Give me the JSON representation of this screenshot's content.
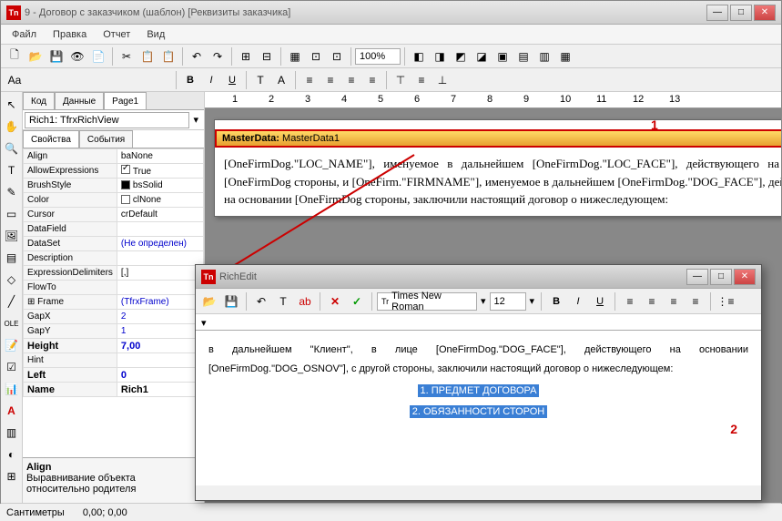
{
  "window": {
    "title": "9 - Договор с заказчиком (шаблон) [Реквизиты заказчика]"
  },
  "menu": {
    "file": "Файл",
    "edit": "Правка",
    "report": "Отчет",
    "view": "Вид"
  },
  "zoom": "100%",
  "pagetabs": {
    "code": "Код",
    "data": "Данные",
    "page": "Page1"
  },
  "objsel": "Rich1: TfrxRichView",
  "proptabs": {
    "props": "Свойства",
    "events": "События"
  },
  "props": [
    {
      "n": "Align",
      "v": "baNone"
    },
    {
      "n": "AllowExpressions",
      "v": "True",
      "chk": true,
      "blue": false
    },
    {
      "n": "BrushStyle",
      "v": "bsSolid",
      "sq": "#000"
    },
    {
      "n": "Color",
      "v": "clNone",
      "sq": "#fff"
    },
    {
      "n": "Cursor",
      "v": "crDefault"
    },
    {
      "n": "DataField",
      "v": ""
    },
    {
      "n": "DataSet",
      "v": "(Не определен)",
      "blue": true
    },
    {
      "n": "Description",
      "v": ""
    },
    {
      "n": "ExpressionDelimiters",
      "v": "[,]"
    },
    {
      "n": "FlowTo",
      "v": ""
    },
    {
      "n": "Frame",
      "v": "(TfrxFrame)",
      "blue": true,
      "exp": true
    },
    {
      "n": "GapX",
      "v": "2",
      "blue": true
    },
    {
      "n": "GapY",
      "v": "1",
      "blue": true
    },
    {
      "n": "Height",
      "v": "7,00",
      "blue": true,
      "bold": true
    },
    {
      "n": "Hint",
      "v": ""
    },
    {
      "n": "Left",
      "v": "0",
      "blue": true,
      "bold": true
    },
    {
      "n": "Name",
      "v": "Rich1",
      "bold": true
    }
  ],
  "propdesc": {
    "title": "Align",
    "text": "Выравнивание объекта относительно родителя"
  },
  "status": {
    "l": "Сантиметры",
    "r": "0,00; 0,00"
  },
  "band": {
    "label": "MasterData:",
    "name": "MasterData1"
  },
  "ruler": [
    "1",
    "2",
    "3",
    "4",
    "5",
    "6",
    "7",
    "8",
    "9",
    "10",
    "11",
    "12",
    "13"
  ],
  "doc": "[OneFirmDog.\"LOC_NAME\"], именуемое в дальнейшем [OneFirmDog.\"LOC_FACE\"], действующего на основании [OneFirmDog стороны, и [OneFirm.\"FIRMNAME\"], именуемое в дальнейшем [OneFirmDog.\"DOG_FACE\"], действующего на основании [OneFirmDog стороны, заключили настоящий договор о нижеследующем:",
  "subwin": {
    "title": "RichEdit"
  },
  "subfont": "Times New Roman",
  "subsize": "12",
  "subtext": "в дальнейшем \"Клиент\", в лице [OneFirmDog.\"DOG_FACE\"], действующего на основании [OneFirmDog.\"DOG_OSNOV\"], с другой стороны, заключили настоящий договор о нижеследующем:",
  "sec1": "1. ПРЕДМЕТ ДОГОВОРА",
  "sec2": "2. ОБЯЗАННОСТИ СТОРОН",
  "ann1": "1",
  "ann2": "2"
}
